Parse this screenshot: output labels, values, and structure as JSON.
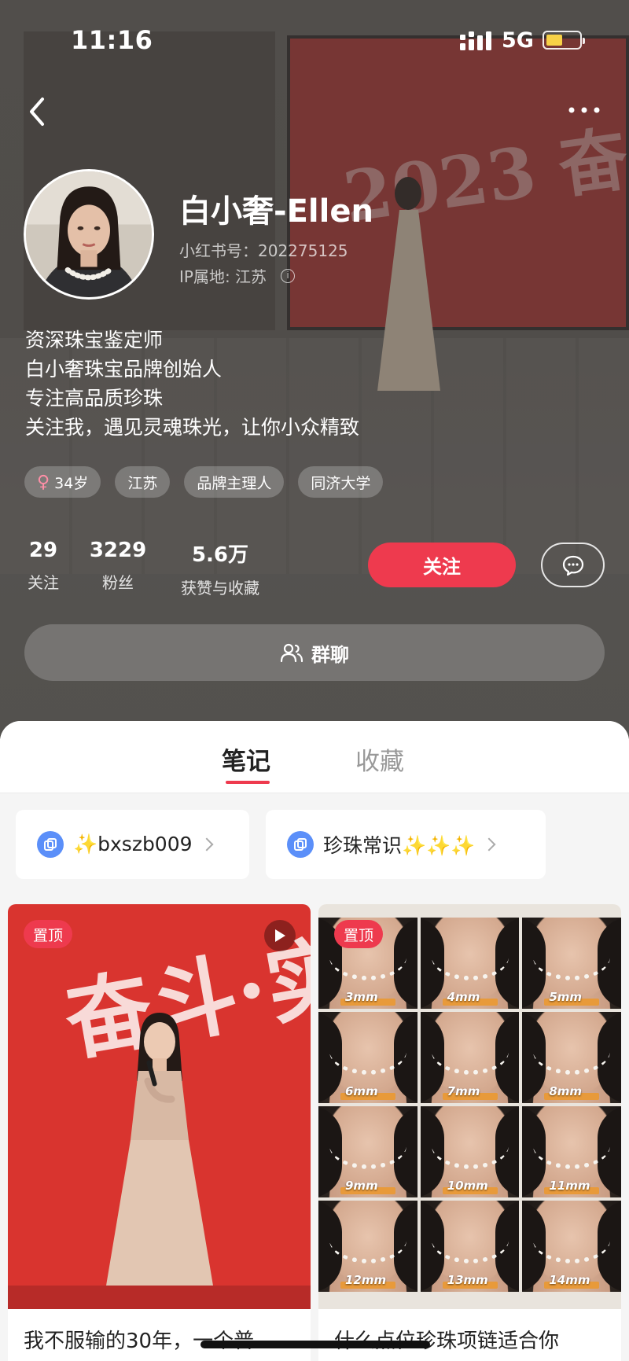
{
  "status_bar": {
    "time": "11:16",
    "network": "5G"
  },
  "profile": {
    "name": "白小奢-Ellen",
    "red_id": "小红书号：202275125",
    "ip_location": "IP属地: 江苏",
    "bio": [
      "资深珠宝鉴定师",
      "白小奢珠宝品牌创始人",
      "专注高品质珍珠",
      "关注我，遇见灵魂珠光，让你小众精致"
    ],
    "tags": [
      {
        "label": "34岁",
        "icon": "female-icon"
      },
      {
        "label": "江苏"
      },
      {
        "label": "品牌主理人"
      },
      {
        "label": "同济大学"
      }
    ]
  },
  "stats": [
    {
      "value": "29",
      "label": "关注"
    },
    {
      "value": "3229",
      "label": "粉丝"
    },
    {
      "value": "5.6万",
      "label": "获赞与收藏"
    }
  ],
  "actions": {
    "follow": "关注",
    "group_chat": "群聊"
  },
  "tabs": [
    {
      "label": "笔记",
      "active": true
    },
    {
      "label": "收藏",
      "active": false
    }
  ],
  "collections": [
    {
      "label": "✨bxszb009"
    },
    {
      "label": "珍珠常识✨✨✨"
    }
  ],
  "notes": [
    {
      "badge": "置顶",
      "title": "我不服输的30年，一个普",
      "has_video": true
    },
    {
      "badge": "置顶",
      "title": "什么点位珍珠项链适合你"
    }
  ],
  "pearl_sizes": [
    "3mm",
    "4mm",
    "5mm",
    "6mm",
    "7mm",
    "8mm",
    "9mm",
    "10mm",
    "11mm",
    "12mm",
    "13mm",
    "14mm"
  ],
  "colors": {
    "accent": "#ee3a4e",
    "battery": "#f7d147",
    "collection_icon": "#5b8ff9"
  }
}
